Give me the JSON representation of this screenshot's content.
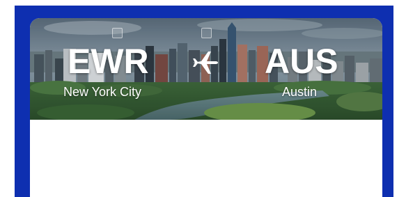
{
  "route": {
    "origin_code": "EWR",
    "origin_city": "New York City",
    "destination_code": "AUS",
    "destination_city": "Austin"
  },
  "icons": {
    "separator": "airplane-icon"
  },
  "colors": {
    "frame": "#0e2fb0",
    "card": "#ffffff",
    "text": "#ffffff"
  }
}
